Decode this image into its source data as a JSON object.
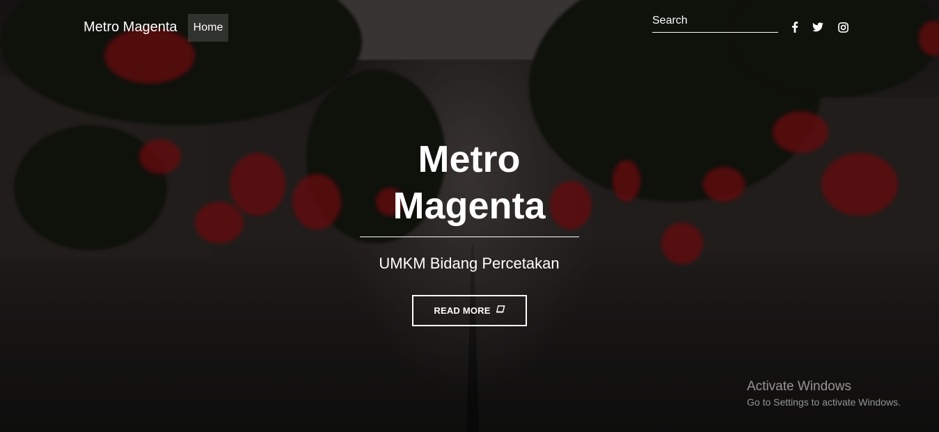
{
  "navbar": {
    "brand": "Metro Magenta",
    "links": [
      {
        "label": "Home"
      }
    ],
    "search_placeholder": "Search",
    "social_icons": [
      "facebook-icon",
      "twitter-icon",
      "instagram-icon"
    ]
  },
  "hero": {
    "title_line1": "Metro",
    "title_line2": "Magenta",
    "subtitle": "UMKM Bidang Percetakan",
    "button_label": "READ MORE",
    "button_icon": "book-icon"
  },
  "watermark": {
    "title": "Activate Windows",
    "subtitle": "Go to Settings to activate Windows."
  },
  "colors": {
    "text": "#ffffff",
    "petal": "#8a0e12",
    "background": "#1a1716"
  }
}
